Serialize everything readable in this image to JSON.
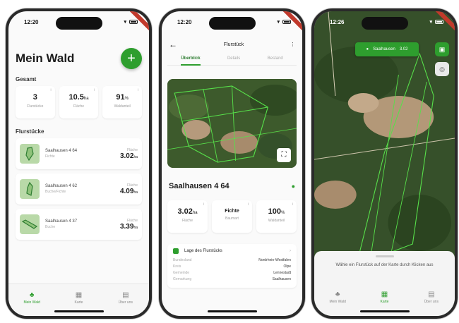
{
  "phones": [
    {
      "status": {
        "time": "12:20"
      },
      "title": "Mein Wald",
      "add_label": "+",
      "section_total": "Gesamt",
      "stats": [
        {
          "value": "3",
          "unit": "",
          "label": "Flurstücke"
        },
        {
          "value": "10.5",
          "unit": "ha",
          "label": "Fläche"
        },
        {
          "value": "91",
          "unit": "%",
          "label": "Waldanteil"
        }
      ],
      "section_parcels": "Flurstücke",
      "parcels": [
        {
          "name": "Saalhausen 4 64",
          "sub": "Fichte",
          "area_label": "Fläche",
          "area": "3.02",
          "unit": "ha"
        },
        {
          "name": "Saalhausen 4 62",
          "sub": "Buche/Fichte",
          "area_label": "Fläche",
          "area": "4.09",
          "unit": "ha"
        },
        {
          "name": "Saalhausen 4 37",
          "sub": "Buche",
          "area_label": "Fläche",
          "area": "3.39",
          "unit": "ha"
        }
      ],
      "tabs": [
        {
          "label": "Mein Wald"
        },
        {
          "label": "Karte"
        },
        {
          "label": "Über uns"
        }
      ]
    },
    {
      "status": {
        "time": "12:20"
      },
      "header_title": "Flurstück",
      "tabs": [
        {
          "label": "Überblick"
        },
        {
          "label": "Details"
        },
        {
          "label": "Bestand"
        }
      ],
      "parcel_name": "Saalhausen 4 64",
      "stats": [
        {
          "value": "3.02",
          "unit": "ha",
          "label": "Fläche"
        },
        {
          "value": "Fichte",
          "unit": "",
          "label": "Baumart"
        },
        {
          "value": "100",
          "unit": "%",
          "label": "Waldanteil"
        }
      ],
      "lage_title": "Lage des Flurstücks",
      "lage_rows": [
        {
          "key": "Bundesland",
          "value": "Nordrhein-Westfalen"
        },
        {
          "key": "Kreis",
          "value": "Olpe"
        },
        {
          "key": "Gemeinde",
          "value": "Lennestadt"
        },
        {
          "key": "Gemarkung",
          "value": "Saalhausen"
        }
      ]
    },
    {
      "status": {
        "time": "12:26"
      },
      "selected_pill": {
        "name": "Saalhausen",
        "area": "3.02"
      },
      "sheet_message": "Wähle ein Flurstück auf der Karte durch Klicken aus",
      "tabs": [
        {
          "label": "Mein Wald"
        },
        {
          "label": "Karte"
        },
        {
          "label": "Über uns"
        }
      ]
    }
  ],
  "colors": {
    "accent": "#2e9e2e",
    "ribbon": "#c0392b"
  },
  "icons": [
    "add-icon",
    "back-icon",
    "more-icon",
    "forest-icon",
    "map-icon",
    "info-icon",
    "pin-icon",
    "expand-icon",
    "layers-icon",
    "locate-icon"
  ]
}
